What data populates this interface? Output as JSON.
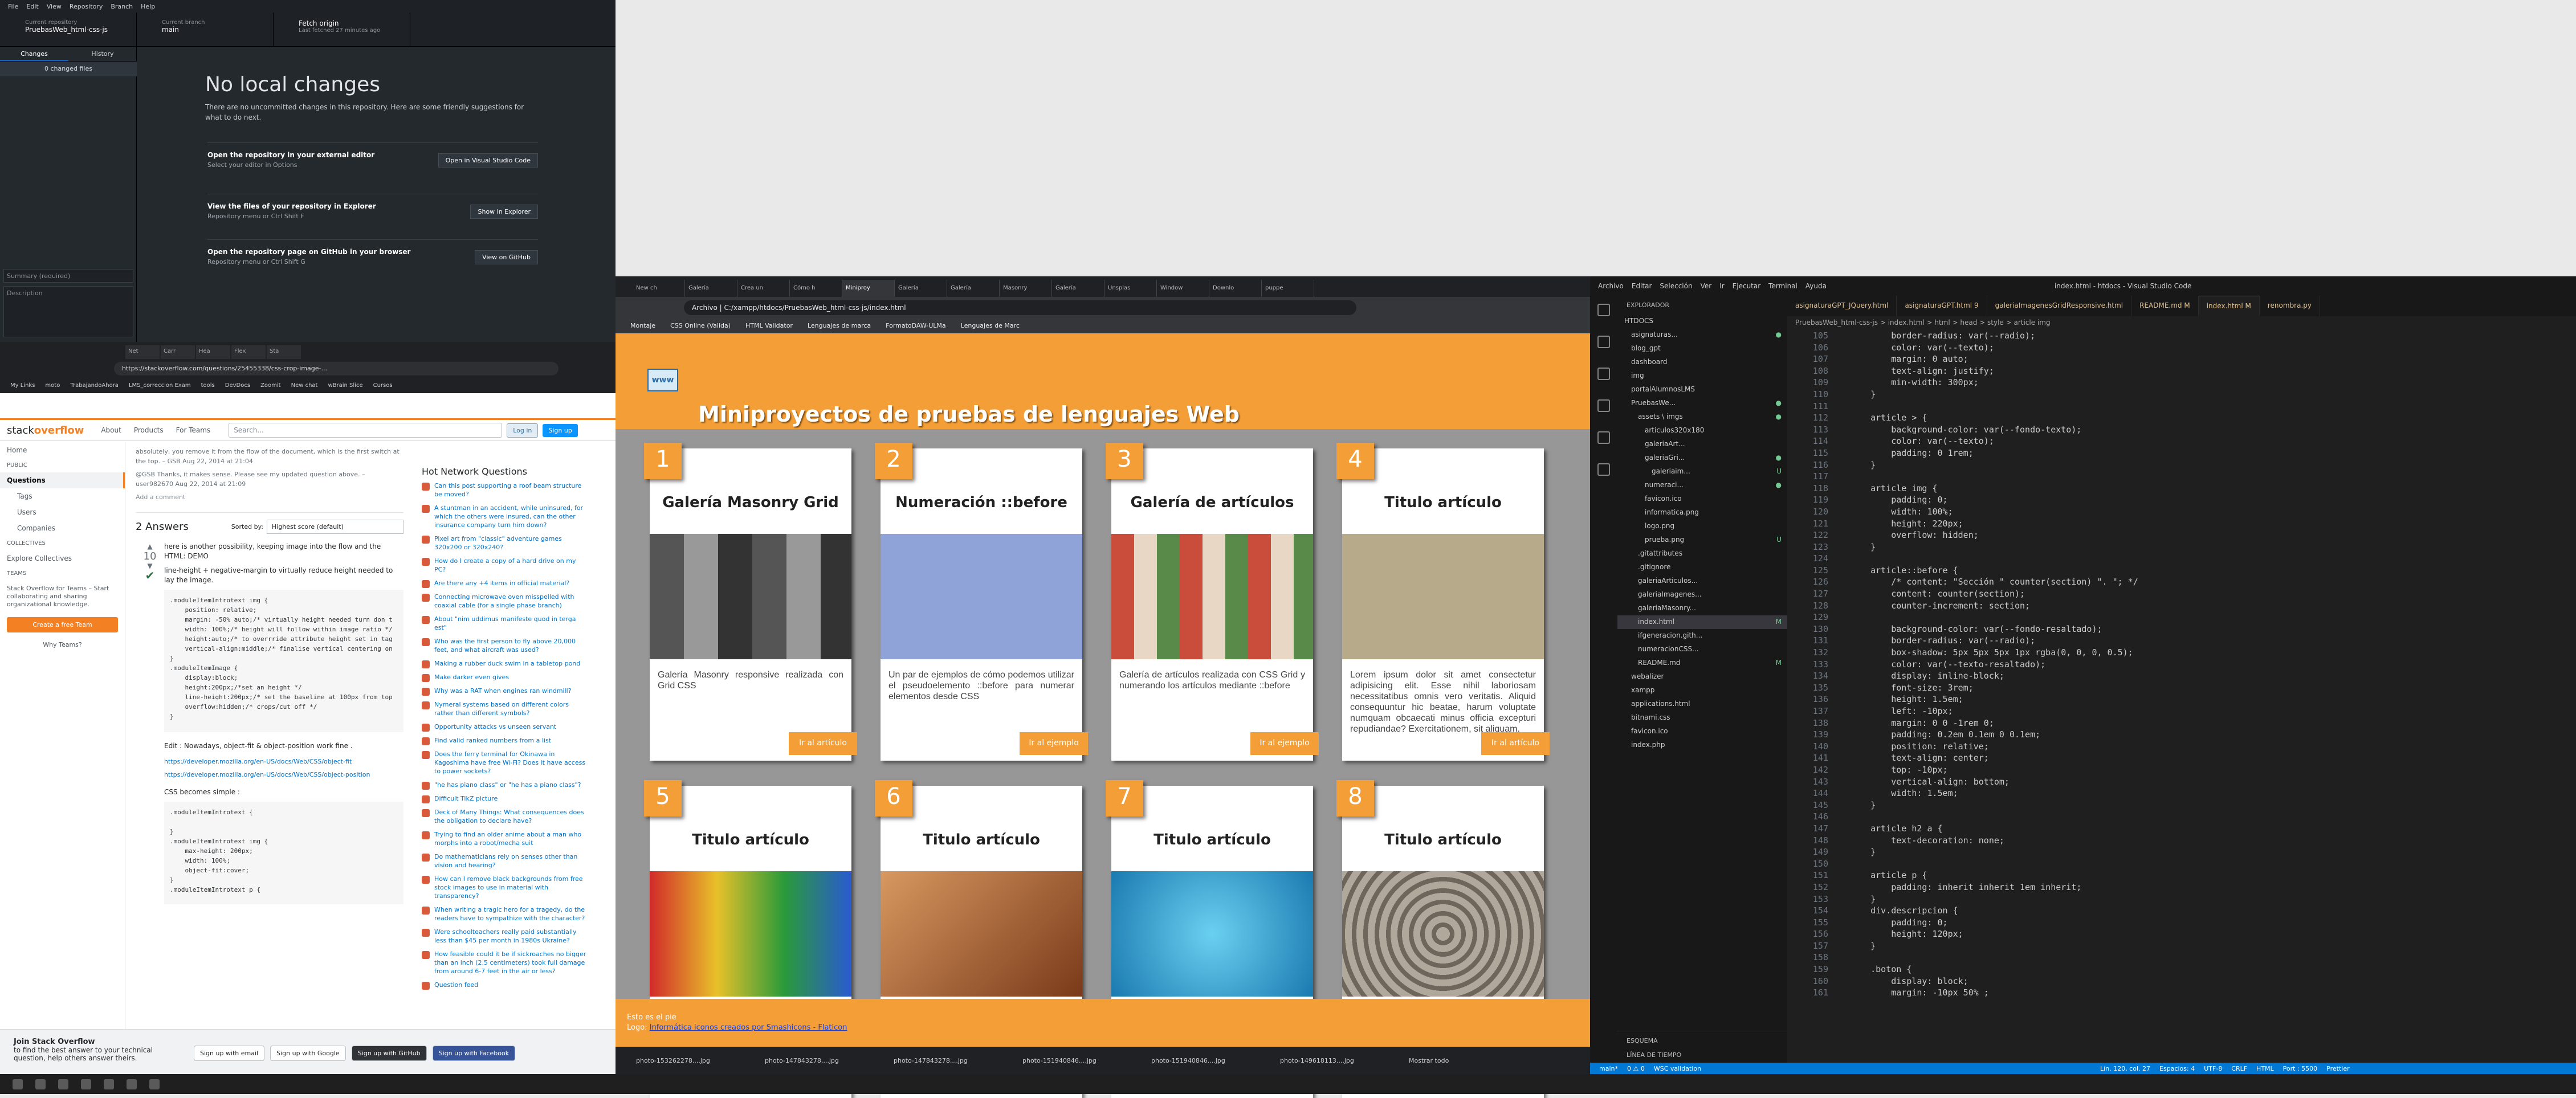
{
  "github": {
    "menu": [
      "File",
      "Edit",
      "View",
      "Repository",
      "Branch",
      "Help"
    ],
    "repo_label": "Current repository",
    "repo_value": "PruebasWeb_html-css-js",
    "branch_label": "Current branch",
    "branch_value": "main",
    "fetch_label": "Fetch origin",
    "fetch_sub": "Last fetched 27 minutes ago",
    "tab_changes": "Changes",
    "tab_history": "History",
    "changed_files": "0 changed files",
    "heading": "No local changes",
    "subtext": "There are no uncommitted changes in this repository. Here are some friendly suggestions for what to do next.",
    "cards": [
      {
        "title": "Open the repository in your external editor",
        "desc": "Select your editor in Options",
        "button": "Open in Visual Studio Code"
      },
      {
        "title": "View the files of your repository in Explorer",
        "desc": "Repository menu or Ctrl Shift F",
        "button": "Show in Explorer"
      },
      {
        "title": "Open the repository page on GitHub in your browser",
        "desc": "Repository menu or Ctrl Shift G",
        "button": "View on GitHub"
      }
    ],
    "summary_placeholder": "Summary (required)",
    "description_placeholder": "Description"
  },
  "stackoverflow": {
    "tabs": [
      "Net",
      "Carr",
      "Hea",
      "Flex",
      "Sta"
    ],
    "url": "https://stackoverflow.com/questions/25455338/css-crop-image-...",
    "bookmarks": [
      "My Links",
      "moto",
      "TrabajandoAhora",
      "LMS_correccion Exam",
      "tools",
      "DevDocs",
      "Zoomit",
      "New chat",
      "wBrain Slice",
      "Cursos"
    ],
    "logo_a": "stack",
    "logo_b": "overflow",
    "nav": [
      "About",
      "Products",
      "For Teams"
    ],
    "search_placeholder": "Search...",
    "login": "Log in",
    "signup": "Sign up",
    "sidebar": [
      "Home",
      "PUBLIC",
      "Questions",
      "Tags",
      "Users",
      "Companies",
      "COLLECTIVES",
      "Explore Collectives",
      "TEAMS",
      "Stack Overflow for Teams – Start collaborating and sharing organizational knowledge.",
      "Create a free Team",
      "Why Teams?"
    ],
    "comment1": "absolutely, you remove it from the flow of the document, which is the first switch at the top. – GSB Aug 22, 2014 at 21:04",
    "comment2": "@GSB Thanks, it makes sense. Please see my updated question above. – user982670 Aug 22, 2014 at 21:09",
    "add_comment": "Add a comment",
    "answers_count": "2 Answers",
    "sorted_by": "Sorted by:",
    "sort_value": "Highest score (default)",
    "vote": "10",
    "answer_text1": "here is another possibility, keeping image into the flow and the HTML: DEMO",
    "answer_text2": "line-height + negative-margin to virtually reduce height needed to lay the image.",
    "code1": ".moduleItemIntrotext img {\n    position: relative;\n    margin: -50% auto;/* virtually height needed turn don t\n    width: 100%;/* height will follow within image ratio */\n    height:auto;/* to overrride attribute height set in tag\n    vertical-align:middle;/* finalise vertical centering on\n}\n.moduleItemImage {\n    display:block;\n    height:200px;/*set an height */\n    line-height:200px;/* set the baseline at 100px from top\n    overflow:hidden;/* crops/cut off */\n}",
    "edit_text": "Edit : Nowadays, object-fit & object-position work fine .",
    "link1": "https://developer.mozilla.org/en-US/docs/Web/CSS/object-fit",
    "link2": "https://developer.mozilla.org/en-US/docs/Web/CSS/object-position",
    "css_simple": "CSS becomes simple :",
    "code2": ".moduleItemIntrotext {\n\n}\n.moduleItemIntrotext img {\n    max-height: 200px;\n    width: 100%;\n    object-fit:cover;\n}\n.moduleItemIntrotext p {\n\n}",
    "hot_title": "Hot Network Questions",
    "hot": [
      "Can this post supporting a roof beam structure be moved?",
      "A stuntman in an accident, while uninsured, for which the others were insured, can the other insurance company turn him down?",
      "Pixel art from \"classic\" adventure games 320x200 or 320x240?",
      "How do I create a copy of a hard drive on my PC?",
      "Are there any +4 items in official material?",
      "Connecting microwave oven misspelled with coaxial cable (for a single phase branch)",
      "About \"nim uddimus manifeste quod in terga est\"",
      "Who was the first person to fly above 20,000 feet, and what aircraft was used?",
      "Making a rubber duck swim in a tabletop pond",
      "Make darker even gives",
      "Why was a RAT when engines ran windmill?",
      "Nymeral systems based on different colors rather than different symbols?",
      "Opportunity attacks vs unseen servant",
      "Find valid ranked numbers from a list",
      "Does the ferry terminal for Okinawa in Kagoshima have free Wi-Fi? Does it have access to power sockets?",
      "\"he has piano class\" or \"he has a piano class\"?",
      "Difficult TikZ picture",
      "Deck of Many Things: What consequences does the obligation to declare have?",
      "Trying to find an older anime about a man who morphs into a robot/mecha suit",
      "Do mathematicians rely on senses other than vision and hearing?",
      "How can I remove black backgrounds from free stock images to use in material with transparency?",
      "When writing a tragic hero for a tragedy, do the readers have to sympathize with the character?",
      "Were schoolteachers really paid substantially less than $45 per month in 1980s Ukraine?",
      "How feasible could it be if sickroaches no bigger than an inch (2.5 centimeters) took full damage from around 6-7 feet in the air or less?",
      "Question feed"
    ],
    "join_title": "Join Stack Overflow",
    "join_text": "to find the best answer to your technical question, help others answer theirs.",
    "join_buttons": [
      "Sign up with email",
      "Sign up with Google",
      "Sign up with GitHub",
      "Sign up with Facebook"
    ]
  },
  "browser": {
    "tabs": [
      "New ch",
      "Galería",
      "Crea un",
      "Cómo h",
      "Miniproy",
      "Galería",
      "Galería",
      "Masonry",
      "Galería",
      "Unsplas",
      "Window",
      "Downlo",
      "puppe"
    ],
    "url": "Archivo | C:/xampp/htdocs/PruebasWeb_html-css-js/index.html",
    "bookmarks": [
      "Montaje",
      "CSS Online (Valida)",
      "HTML Validator",
      "Lenguajes de marca",
      "FormatoDAW-ULMa",
      "Lenguajes de Marc"
    ]
  },
  "site": {
    "logo": "www",
    "title": "Miniproyectos de pruebas de lenguajes Web",
    "cards": [
      {
        "n": "1",
        "title": "Galería Masonry Grid",
        "text": "Galería Masonry responsive realizada con Grid CSS",
        "btn": "Ir al artículo"
      },
      {
        "n": "2",
        "title": "Numeración ::before",
        "text": "Un par de ejemplos de cómo podemos utilizar el pseudoelemento ::before para numerar elementos desde CSS",
        "btn": "Ir al ejemplo"
      },
      {
        "n": "3",
        "title": "Galería de artículos",
        "text": "Galería de artículos realizada con CSS Grid y numerando los artículos mediante ::before",
        "btn": "Ir al ejemplo"
      },
      {
        "n": "4",
        "title": "Titulo artículo",
        "text": "Lorem ipsum dolor sit amet consectetur adipisicing elit. Esse nihil laboriosam necessitatibus omnis vero veritatis. Aliquid consequuntur hic beatae, harum voluptate numquam obcaecati minus officia excepturi repudiandae? Exercitationem, sit aliquam.",
        "btn": "Ir al artículo"
      },
      {
        "n": "5",
        "title": "Titulo artículo",
        "text": "",
        "btn": ""
      },
      {
        "n": "6",
        "title": "Titulo artículo",
        "text": "",
        "btn": ""
      },
      {
        "n": "7",
        "title": "Titulo artículo",
        "text": "",
        "btn": ""
      },
      {
        "n": "8",
        "title": "Titulo artículo",
        "text": "",
        "btn": ""
      }
    ],
    "footer_line1": "Esto es el pie",
    "footer_line2_prefix": "Logo:",
    "footer_link": "Informática iconos creados por Smashicons - Flaticon"
  },
  "downloads": [
    "photo-153262278....jpg",
    "photo-147843278....jpg",
    "photo-147843278....jpg",
    "photo-151940846....jpg",
    "photo-151940846....jpg",
    "photo-149618113....jpg"
  ],
  "downloads_show_all": "Mostrar todo",
  "vscode": {
    "menu": [
      "Archivo",
      "Editar",
      "Selección",
      "Ver",
      "Ir",
      "Ejecutar",
      "Terminal",
      "Ayuda"
    ],
    "window_title": "index.html - htdocs - Visual Studio Code",
    "explorer_title": "EXPLORADOR",
    "tree": [
      {
        "t": "HTDOCS",
        "d": 0,
        "m": ""
      },
      {
        "t": "asignaturas...",
        "d": 1,
        "m": "●"
      },
      {
        "t": "blog_gpt",
        "d": 1,
        "m": ""
      },
      {
        "t": "dashboard",
        "d": 1,
        "m": ""
      },
      {
        "t": "img",
        "d": 1,
        "m": ""
      },
      {
        "t": "portalAlumnosLMS",
        "d": 1,
        "m": ""
      },
      {
        "t": "PruebasWe...",
        "d": 1,
        "m": "●"
      },
      {
        "t": "assets \\ imgs",
        "d": 2,
        "m": "●"
      },
      {
        "t": "articulos320x180",
        "d": 3,
        "m": ""
      },
      {
        "t": "galeriaArt...",
        "d": 3,
        "m": ""
      },
      {
        "t": "galeriaGri...",
        "d": 3,
        "m": "●"
      },
      {
        "t": "galeriaim...",
        "d": 4,
        "m": "U"
      },
      {
        "t": "numeraci...",
        "d": 3,
        "m": "●"
      },
      {
        "t": "favicon.ico",
        "d": 3,
        "m": ""
      },
      {
        "t": "informatica.png",
        "d": 3,
        "m": ""
      },
      {
        "t": "logo.png",
        "d": 3,
        "m": ""
      },
      {
        "t": "prueba.png",
        "d": 3,
        "m": "U"
      },
      {
        "t": ".gitattributes",
        "d": 2,
        "m": ""
      },
      {
        "t": ".gitignore",
        "d": 2,
        "m": ""
      },
      {
        "t": "galeriaArticulos...",
        "d": 2,
        "m": ""
      },
      {
        "t": "galeriaImagenes...",
        "d": 2,
        "m": ""
      },
      {
        "t": "galeriaMasonry...",
        "d": 2,
        "m": ""
      },
      {
        "t": "index.html",
        "d": 2,
        "m": "M"
      },
      {
        "t": "ifgeneracion.gith...",
        "d": 2,
        "m": ""
      },
      {
        "t": "numeracionCSS...",
        "d": 2,
        "m": ""
      },
      {
        "t": "README.md",
        "d": 2,
        "m": "M"
      },
      {
        "t": "webalizer",
        "d": 1,
        "m": ""
      },
      {
        "t": "xampp",
        "d": 1,
        "m": ""
      },
      {
        "t": "applications.html",
        "d": 1,
        "m": ""
      },
      {
        "t": "bitnami.css",
        "d": 1,
        "m": ""
      },
      {
        "t": "favicon.ico",
        "d": 1,
        "m": ""
      },
      {
        "t": "index.php",
        "d": 1,
        "m": ""
      }
    ],
    "outline": "ESQUEMA",
    "timeline": "LÍNEA DE TIEMPO",
    "tabs": [
      "asignaturaGPT_JQuery.html",
      "asignaturaGPT.html 9",
      "galeriaImagenesGridResponsive.html",
      "README.md M",
      "index.html M",
      "renombra.py"
    ],
    "breadcrumb": "PruebasWeb_html-css-js > index.html > html > head > style > article img",
    "line_start": 105,
    "code": "        border-radius: var(--radio);\n        color: var(--texto);\n        margin: 0 auto;\n        text-align: justify;\n        min-width: 300px;\n    }\n\n    article > {\n        background-color: var(--fondo-texto);\n        color: var(--texto);\n        padding: 0 1rem;\n    }\n\n    article img {\n        padding: 0;\n        width: 100%;\n        height: 220px;\n        overflow: hidden;\n    }\n\n    article::before {\n        /* content: \"Sección \" counter(section) \". \"; */\n        content: counter(section);\n        counter-increment: section;\n\n        background-color: var(--fondo-resaltado);\n        border-radius: var(--radio);\n        box-shadow: 5px 5px 5px 1px rgba(0, 0, 0, 0.5);\n        color: var(--texto-resaltado);\n        display: inline-block;\n        font-size: 3rem;\n        height: 1.5em;\n        left: -10px;\n        margin: 0 0 -1rem 0;\n        padding: 0.2em 0.1em 0 0.1em;\n        position: relative;\n        text-align: center;\n        top: -10px;\n        vertical-align: bottom;\n        width: 1.5em;\n    }\n\n    article h2 a {\n        text-decoration: none;\n    }\n\n    article p {\n        padding: inherit inherit 1em inherit;\n    }\n    div.descripcion {\n        padding: 0;\n        height: 120px;\n    }\n\n    .boton {\n        display: block;\n        margin: -10px 50% ;",
    "status": [
      "main*",
      "0 ⚠ 0",
      "WSC validation",
      "Lín. 120, col. 27",
      "Espacios: 4",
      "UTF-8",
      "CRLF",
      "HTML",
      "Port : 5500",
      "Prettier"
    ]
  }
}
